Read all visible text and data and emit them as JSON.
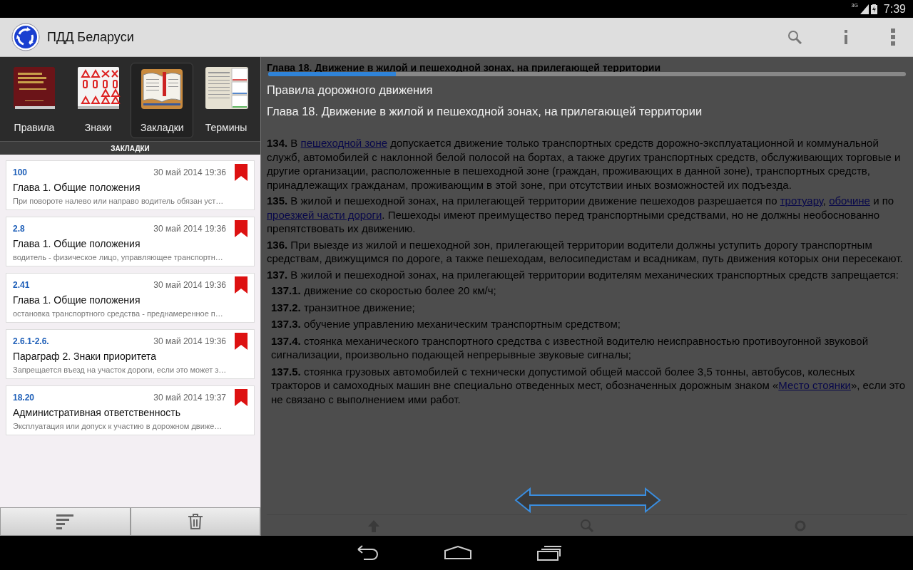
{
  "status_bar": {
    "network": "3G",
    "time": "7:39"
  },
  "action_bar": {
    "title": "ПДД Беларуси"
  },
  "shelf": [
    {
      "label": "Правила",
      "kind": "rules",
      "selected": false
    },
    {
      "label": "Знаки",
      "kind": "signs",
      "selected": false
    },
    {
      "label": "Закладки",
      "kind": "bookmarks",
      "selected": true
    },
    {
      "label": "Термины",
      "kind": "terms",
      "selected": false
    }
  ],
  "section_header": "ЗАКЛАДКИ",
  "bookmarks": [
    {
      "ref": "100",
      "date": "30 май 2014 19:36",
      "title": "Глава 1. Общие положения",
      "snippet": "При повороте налево или направо водитель обязан уст…"
    },
    {
      "ref": "2.8",
      "date": "30 май 2014 19:36",
      "title": "Глава 1. Общие положения",
      "snippet": "водитель - физическое лицо, управляющее транспортн…"
    },
    {
      "ref": "2.41",
      "date": "30 май 2014 19:36",
      "title": "Глава 1. Общие положения",
      "snippet": "остановка транспортного средства - преднамеренное п…"
    },
    {
      "ref": "2.6.1-2.6.",
      "date": "30 май 2014 19:36",
      "title": "Параграф 2. Знаки приоритета",
      "snippet": "Запрещается въезд на участок дороги, если это может з…"
    },
    {
      "ref": "18.20",
      "date": "30 май 2014 19:37",
      "title": "Административная ответственность",
      "snippet": "Эксплуатация или допуск к участию в дорожном движе…"
    }
  ],
  "reader": {
    "heading": "Глава 18. Движение в жилой и пешеходной зонах, на прилегающей территории",
    "loading": {
      "level": 0.2,
      "book": "Правила дорожного движения",
      "chapter": "Глава 18. Движение в жилой и пешеходной зонах, на прилегающей территории"
    },
    "paragraphs": [
      {
        "kind": "para",
        "num": "134.",
        "segments": [
          {
            "text": " В ",
            "link": false
          },
          {
            "text": "пешеходной зоне",
            "link": true
          },
          {
            "text": " допускается движение только транспортных средств дорожно-эксплуатационной и коммунальной служб, автомобилей с наклонной белой полосой на бортах, а также других транспортных средств, обслуживающих торговые и другие организации, расположенные в пешеходной зоне (граждан, проживающих в данной зоне), транспортных средств, принадлежащих гражданам, проживающим в этой зоне, при отсутствии иных возможностей их подъезда.",
            "link": false
          }
        ]
      },
      {
        "kind": "para",
        "num": "135.",
        "segments": [
          {
            "text": " В жилой и пешеходной зонах, на прилегающей территории движение пешеходов разрешается по ",
            "link": false
          },
          {
            "text": "тротуару",
            "link": true
          },
          {
            "text": ", ",
            "link": false
          },
          {
            "text": "обочине",
            "link": true
          },
          {
            "text": " и по ",
            "link": false
          },
          {
            "text": "проезжей части дороги",
            "link": true
          },
          {
            "text": ". Пешеходы имеют преимущество перед транспортными средствами, но не должны необоснованно препятствовать их движению.",
            "link": false
          }
        ]
      },
      {
        "kind": "para",
        "num": "136.",
        "segments": [
          {
            "text": " При выезде из жилой и пешеходной зон, прилегающей территории водители должны уступить дорогу транспортным средствам, движущимся по дороге, а также пешеходам, велосипедистам и всадникам, путь движения которых они пересекают.",
            "link": false
          }
        ]
      },
      {
        "kind": "para",
        "num": "137.",
        "segments": [
          {
            "text": " В жилой и пешеходной зонах, на прилегающей территории водителям механических транспортных средств запрещается:",
            "link": false
          }
        ]
      },
      {
        "kind": "item",
        "num": "137.1.",
        "segments": [
          {
            "text": " движение со скоростью более 20 км/ч;",
            "link": false
          }
        ]
      },
      {
        "kind": "item",
        "num": "137.2.",
        "segments": [
          {
            "text": " транзитное движение;",
            "link": false
          }
        ]
      },
      {
        "kind": "item",
        "num": "137.3.",
        "segments": [
          {
            "text": " обучение управлению механическим транспортным средством;",
            "link": false
          }
        ]
      },
      {
        "kind": "item",
        "num": "137.4.",
        "segments": [
          {
            "text": " стоянка механического транспортного средства с известной водителю неисправностью противоугонной звуковой сигнализации, произвольно подающей непрерывные звуковые сигналы;",
            "link": false
          }
        ]
      },
      {
        "kind": "item",
        "num": "137.5.",
        "segments": [
          {
            "text": " стоянка грузовых автомобилей с технически допустимой общей массой более 3,5 тонны, автобусов, колесных тракторов и самоходных машин вне специально отведенных мест, обозначенных дорожным знаком «",
            "link": false
          },
          {
            "text": "Место стоянки",
            "link": true
          },
          {
            "text": "», если это не связано с выполнением ими работ.",
            "link": false
          }
        ]
      }
    ]
  }
}
